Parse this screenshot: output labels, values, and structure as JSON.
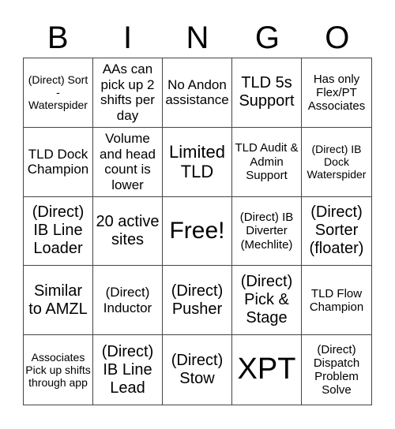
{
  "header": {
    "letters": [
      "B",
      "I",
      "N",
      "G",
      "O"
    ]
  },
  "board": {
    "rows": [
      [
        "(Direct) Sort - Waterspider",
        "AAs can pick up 2 shifts per day",
        "No Andon assistance",
        "TLD 5s Support",
        "Has only Flex/PT Associates"
      ],
      [
        "TLD Dock Champion",
        "Volume and head count is lower",
        "Limited TLD",
        "TLD Audit & Admin Support",
        "(Direct) IB Dock Waterspider"
      ],
      [
        "(Direct) IB Line Loader",
        "20 active sites",
        "Free!",
        "(Direct) IB Diverter (Mechlite)",
        "(Direct) Sorter (floater)"
      ],
      [
        "Similar to AMZL",
        "(Direct) Inductor",
        "(Direct) Pusher",
        "(Direct) Pick & Stage",
        "TLD Flow Champion"
      ],
      [
        "Associates Pick up shifts through app",
        "(Direct) IB Line Lead",
        "(Direct) Stow",
        "XPT",
        "(Direct) Dispatch Problem Solve"
      ]
    ]
  }
}
